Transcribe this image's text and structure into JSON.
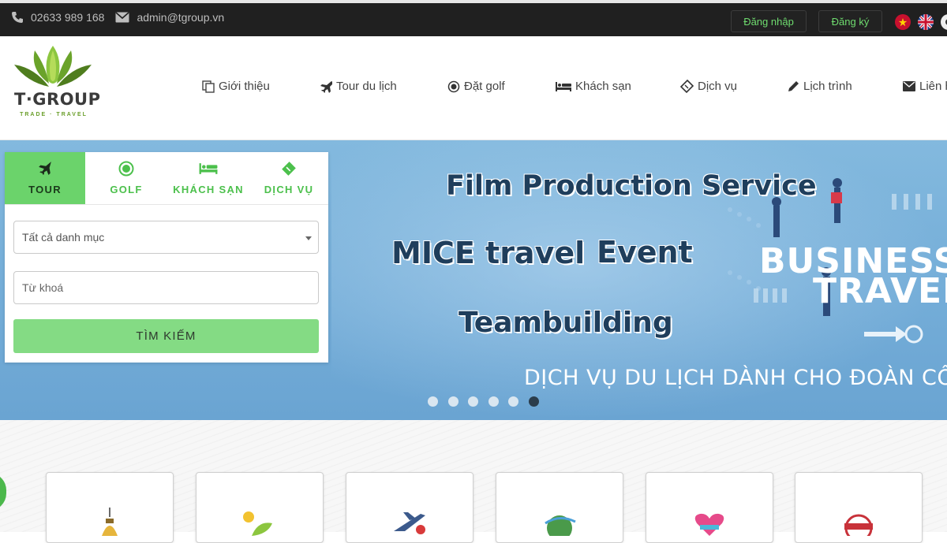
{
  "topbar": {
    "phone": "02633 989 168",
    "email": "admin@tgroup.vn",
    "login_label": "Đăng nhập",
    "register_label": "Đăng ký",
    "languages": [
      "vietnamese-flag",
      "uk-flag",
      "other-flag"
    ]
  },
  "header": {
    "logo": {
      "brand": "T·GROUP",
      "tagline": "TRADE · TRAVEL"
    },
    "nav": [
      {
        "label": "Giới thiệu",
        "icon": "pages-icon"
      },
      {
        "label": "Tour du lịch",
        "icon": "plane-icon"
      },
      {
        "label": "Đặt golf",
        "icon": "golf-icon"
      },
      {
        "label": "Khách sạn",
        "icon": "bed-icon"
      },
      {
        "label": "Dịch vụ",
        "icon": "ticket-icon"
      },
      {
        "label": "Lịch trình",
        "icon": "pencil-icon"
      },
      {
        "label": "Liên h",
        "icon": "envelope-icon"
      }
    ]
  },
  "search_panel": {
    "tabs": [
      {
        "label": "TOUR",
        "icon": "plane-icon",
        "active": true
      },
      {
        "label": "GOLF",
        "icon": "golf-icon",
        "active": false
      },
      {
        "label": "KHÁCH SẠN",
        "icon": "bed-icon",
        "active": false
      },
      {
        "label": "DỊCH VỤ",
        "icon": "ticket-icon",
        "active": false
      }
    ],
    "category_select": "Tất cả danh mục",
    "keyword_placeholder": "Từ khoá",
    "search_label": "TÌM KIẾM"
  },
  "banner": {
    "line1": "Film Production Service",
    "line2a": "MICE travel",
    "line2b": "Event",
    "line3": "Teambuilding",
    "graphic_line1": "BUSINESS",
    "graphic_line2": "TRAVEL",
    "subtitle": "DỊCH VỤ DU LỊCH DÀNH CHO ĐOÀN CÔNG",
    "slides_total": 6,
    "active_slide": 6
  },
  "categories": [
    {
      "icon": "landmark-icon"
    },
    {
      "icon": "sun-leaf-icon"
    },
    {
      "icon": "airplane-icon"
    },
    {
      "icon": "globe-icon"
    },
    {
      "icon": "heart-beach-icon"
    },
    {
      "icon": "promotion-stamp-icon"
    }
  ],
  "colors": {
    "topbar_bg": "#202020",
    "accent_green": "#6bd36b",
    "button_green": "#84db84",
    "banner_blue": "#78b1da"
  }
}
